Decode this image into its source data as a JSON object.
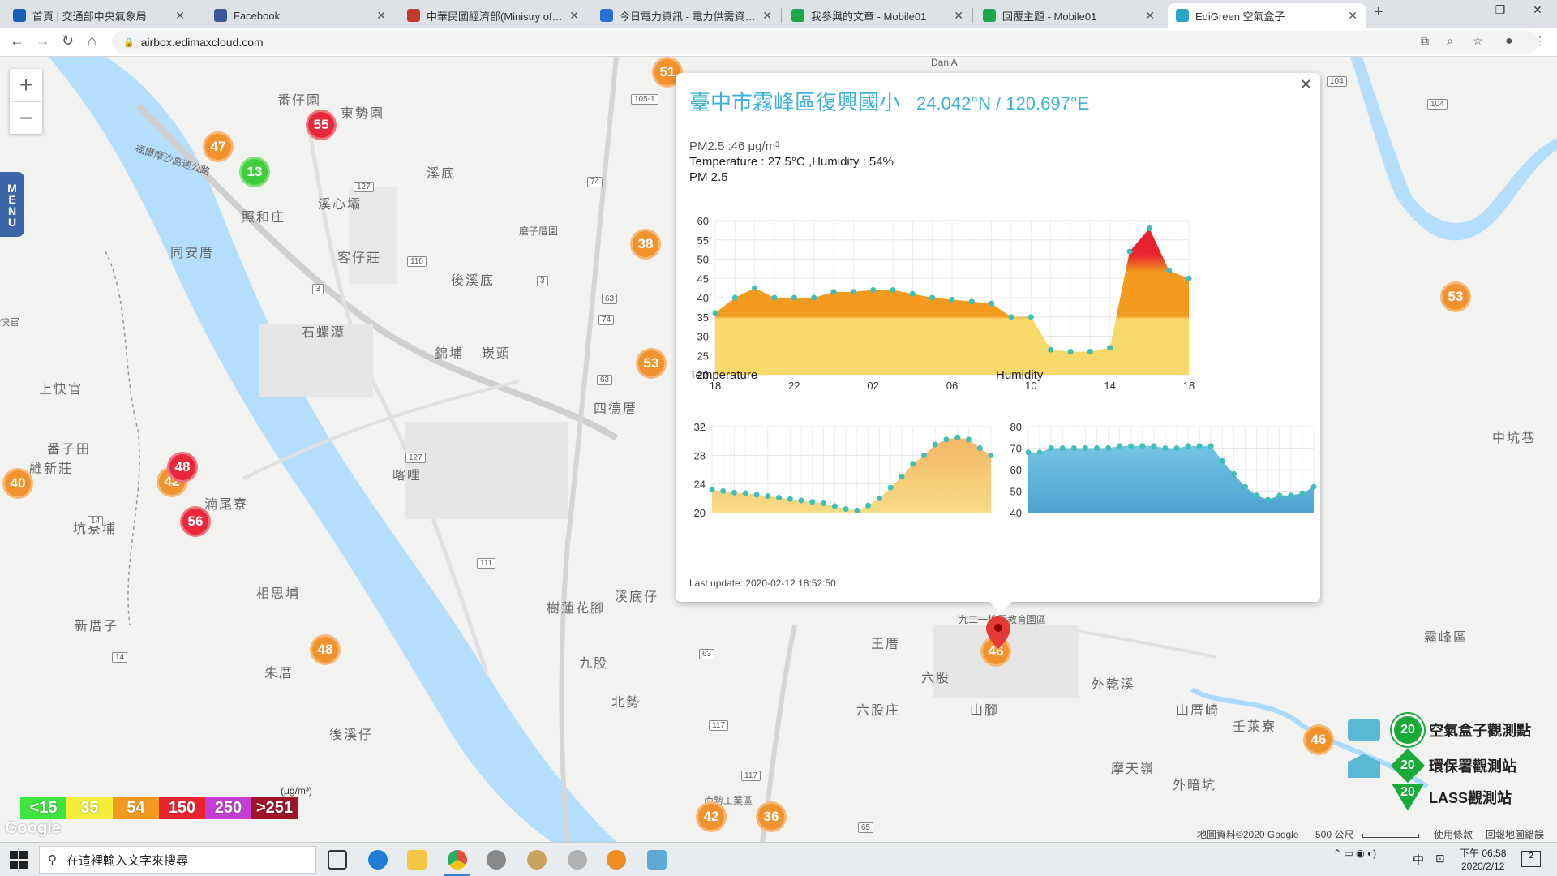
{
  "tabs": [
    {
      "label": "首頁 | 交通部中央氣象局",
      "fav": "eye-icon",
      "color": "#1a5fb4"
    },
    {
      "label": "Facebook",
      "fav": "facebook-icon",
      "color": "#3b5998"
    },
    {
      "label": "中華民國經濟部(Ministry of Eco",
      "fav": "moea-icon",
      "color": "#c0392b"
    },
    {
      "label": "今日電力資訊 - 電力供需資訊 - 雷",
      "fav": "power-icon",
      "color": "#2a6fd6"
    },
    {
      "label": "我參與的文章 - Mobile01",
      "fav": "mobile01-icon",
      "color": "#19a84a"
    },
    {
      "label": "回覆主題 - Mobile01",
      "fav": "mobile01-icon",
      "color": "#19a84a"
    },
    {
      "label": "EdiGreen 空氣盒子",
      "fav": "edigreen-icon",
      "color": "#2aa4c9"
    }
  ],
  "address": {
    "url": "airbox.edimaxcloud.com"
  },
  "map": {
    "places": [
      {
        "t": "番仔園"
      },
      {
        "t": "東勢園"
      },
      {
        "t": "溪底"
      },
      {
        "t": "溪心壩"
      },
      {
        "t": "照和庄"
      },
      {
        "t": "同安厝"
      },
      {
        "t": "客仔莊"
      },
      {
        "t": "後溪底"
      },
      {
        "t": "石螺潭"
      },
      {
        "t": "錦埔"
      },
      {
        "t": "崁頭"
      },
      {
        "t": "上快官"
      },
      {
        "t": "番子田"
      },
      {
        "t": "維新莊"
      },
      {
        "t": "坑寮埔"
      },
      {
        "t": "相思埔"
      },
      {
        "t": "新厝子"
      },
      {
        "t": "朱厝"
      },
      {
        "t": "後溪仔"
      },
      {
        "t": "九股"
      },
      {
        "t": "北勢"
      },
      {
        "t": "樹蓮花腳"
      },
      {
        "t": "溪底仔"
      },
      {
        "t": "王厝"
      },
      {
        "t": "六股"
      },
      {
        "t": "六股庄"
      },
      {
        "t": "山腳"
      },
      {
        "t": "外乾溪"
      },
      {
        "t": "山厝崎"
      },
      {
        "t": "壬萊寮"
      },
      {
        "t": "摩天嶺"
      },
      {
        "t": "外暗坑"
      },
      {
        "t": "霧峰區"
      },
      {
        "t": "暗坑"
      },
      {
        "t": "中坑巷"
      },
      {
        "t": "四德厝"
      },
      {
        "t": "喀哩"
      },
      {
        "t": "湳尾寮"
      },
      {
        "t": "九二一地震教育園區"
      },
      {
        "t": "磨子厝園"
      },
      {
        "t": "快官"
      },
      {
        "t": "南勢工業區"
      },
      {
        "t": "福爾摩沙高速公路"
      },
      {
        "t": "Dan A"
      }
    ],
    "routes": [
      "127",
      "110",
      "105-1",
      "127",
      "111",
      "117",
      "117",
      "104",
      "104",
      "14",
      "14",
      "3",
      "3",
      "63",
      "63",
      "63",
      "65",
      "74",
      "74"
    ],
    "markers": [
      {
        "v": "55",
        "c": "red"
      },
      {
        "v": "47",
        "c": "orange"
      },
      {
        "v": "13",
        "c": "green"
      },
      {
        "v": "51",
        "c": "orange"
      },
      {
        "v": "38",
        "c": "orange"
      },
      {
        "v": "53",
        "c": "orange"
      },
      {
        "v": "53",
        "c": "orange"
      },
      {
        "v": "40",
        "c": "orange"
      },
      {
        "v": "42",
        "c": "orange"
      },
      {
        "v": "48",
        "c": "red"
      },
      {
        "v": "56",
        "c": "red"
      },
      {
        "v": "48",
        "c": "orange"
      },
      {
        "v": "46",
        "c": "orange"
      },
      {
        "v": "46",
        "c": "orange"
      },
      {
        "v": "42",
        "c": "orange"
      },
      {
        "v": "36",
        "c": "orange"
      }
    ],
    "menu_label": "MENU",
    "legend": {
      "unit": "(μg/m³)",
      "levels": [
        "<15",
        "35",
        "54",
        "150",
        "250",
        ">251"
      ],
      "colors": [
        "#3ee53e",
        "#f2ee3a",
        "#f39a1f",
        "#e8232f",
        "#c33fd1",
        "#a0142a"
      ]
    },
    "station_legend": [
      {
        "label": "空氣盒子觀測點",
        "value": "20",
        "icon": "airbox-icon"
      },
      {
        "label": "環保署觀測站",
        "value": "20",
        "icon": "epa-station-icon"
      },
      {
        "label": "LASS觀測站",
        "value": "20",
        "icon": "lass-station-icon"
      }
    ],
    "google_logo": "Google",
    "attribution": {
      "data": "地圖資料©2020 Google",
      "scale": "500 公尺",
      "terms": "使用條款",
      "report": "回報地圖錯誤"
    }
  },
  "popup": {
    "title": "臺中市霧峰區復興國小",
    "coords": "24.042°N / 120.697°E",
    "pm_line": "PM2.5 :46 μg/m³",
    "temp_line": "Temperature : 27.5°C ,Humidity : 54%",
    "chart_title": "PM 2.5",
    "temp_title": "Temperature",
    "hum_title": "Humidity",
    "last_update": "Last update: 2020-02-12 18:52:50"
  },
  "chart_data": [
    {
      "type": "area",
      "title": "PM 2.5",
      "x_ticks": [
        "18",
        "22",
        "02",
        "06",
        "10",
        "14",
        "18"
      ],
      "ylim": [
        20,
        60
      ],
      "y_ticks": [
        20,
        25,
        30,
        35,
        40,
        45,
        50,
        55,
        60
      ],
      "series": [
        {
          "values": [
            36,
            40,
            42.5,
            40,
            40,
            40,
            41.5,
            41.5,
            42,
            42,
            41,
            40,
            39.5,
            39,
            38.5,
            35,
            35,
            26.5,
            26,
            26,
            27,
            52,
            58,
            47,
            45
          ]
        }
      ]
    },
    {
      "type": "area",
      "title": "Temperature",
      "ylim": [
        20,
        32
      ],
      "y_ticks": [
        20,
        24,
        28,
        32
      ],
      "series": [
        {
          "values": [
            23.2,
            23,
            22.8,
            22.7,
            22.5,
            22.3,
            22.1,
            21.9,
            21.7,
            21.5,
            21.3,
            20.9,
            20.5,
            20.3,
            21,
            22,
            23.5,
            25,
            26.8,
            28,
            29.5,
            30.2,
            30.5,
            30.2,
            29,
            28
          ]
        }
      ]
    },
    {
      "type": "area",
      "title": "Humidity",
      "ylim": [
        40,
        80
      ],
      "y_ticks": [
        40,
        50,
        60,
        70,
        80
      ],
      "series": [
        {
          "values": [
            68,
            68,
            70,
            70,
            70,
            70,
            70,
            70,
            71,
            71,
            71,
            71,
            70,
            70,
            71,
            71,
            71,
            64,
            58,
            52,
            48,
            46,
            48,
            48,
            49,
            52
          ]
        }
      ]
    }
  ],
  "taskbar": {
    "search_placeholder": "在這裡輸入文字來搜尋",
    "ime": "中",
    "time": "下午 06:58",
    "date": "2020/2/12",
    "notif": "2"
  }
}
